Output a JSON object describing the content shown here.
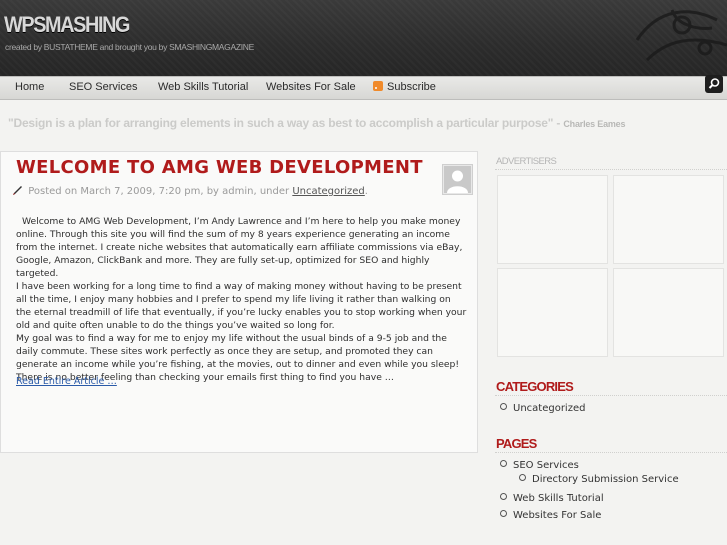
{
  "header": {
    "logo": "WPSMASHING",
    "tagline": "created by BUSTATHEME and brought you by SMASHINGMAGAZINE"
  },
  "nav": {
    "items": [
      "Home",
      "SEO Services",
      "Web Skills Tutorial",
      "Websites For Sale",
      "Subscribe"
    ],
    "search_icon": "search-icon",
    "subscribe_icon": "rss-icon"
  },
  "quote": {
    "text": "\"Design is a plan for arranging elements in such a way as best to accomplish a particular purpose\" -",
    "author": "Charles Eames"
  },
  "post": {
    "title": "WELCOME TO AMG WEB DEVELOPMENT",
    "meta_prefix": "Posted on March 7, 2009, 7:20 pm, by admin, under",
    "meta_category": "Uncategorized",
    "meta_suffix": ".",
    "paragraphs": [
      "Welcome to AMG Web Development, I’m Andy Lawrence and I’m here to help you make money online. Through this site you will find the sum of my 8 years experience generating an income from the internet. I create niche websites that automatically earn affiliate commissions via eBay, Google, Amazon, ClickBank and more. They are fully set-up, optimized for SEO and highly targeted.",
      "I have been working for a long time to find a way of making money without having to be present all the time, I enjoy many hobbies and I prefer to spend my life living it rather than walking on the eternal treadmill of life that eventually, if you’re lucky enables you to stop working when your old and quite often unable to do the things you’ve waited so long for.",
      "My goal was to find a way for me to enjoy my life without the usual binds of a 9-5 job and the daily commute. These sites work perfectly as once they are setup, and promoted they can generate an income while you’re fishing, at the movies, out to dinner and even while you sleep! There is no better feeling than checking your emails first thing to find you have …"
    ],
    "read_more": "Read Entire Article …"
  },
  "sidebar": {
    "advertisers_title": "ADVERTISERS",
    "categories_title": "CATEGORIES",
    "categories": [
      "Uncategorized"
    ],
    "pages_title": "PAGES",
    "pages": {
      "seo_services": "SEO Services",
      "directory_submission": "Directory Submission Service",
      "web_skills": "Web Skills Tutorial",
      "websites_for_sale": "Websites For Sale"
    }
  },
  "colors": {
    "accent": "#b01b1b",
    "header_bg": "#2c2c2c",
    "link": "#2a5aa8"
  }
}
